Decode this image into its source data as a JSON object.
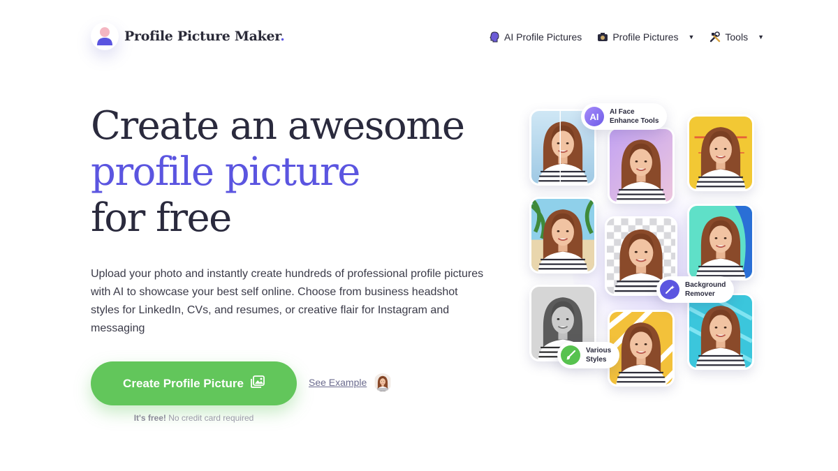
{
  "brand": {
    "name": "Profile Picture Maker",
    "dot": "."
  },
  "nav": {
    "ai_profile_pictures": "AI Profile Pictures",
    "profile_pictures": "Profile Pictures",
    "tools": "Tools"
  },
  "hero": {
    "line1": "Create an awesome",
    "line2": "profile picture",
    "line3": "for free",
    "description": "Upload your photo and instantly create hundreds of professional profile pictures with AI to showcase your best self online. Choose from business headshot styles for LinkedIn, CVs, and resumes, or creative flair for Instagram and messaging"
  },
  "cta": {
    "button_label": "Create Profile Picture",
    "see_example": "See Example",
    "free_bold": "It's free!",
    "free_rest": " No credit card required"
  },
  "collage": {
    "chips": {
      "ai_badge": "AI",
      "ai_line1": "AI Face",
      "ai_line2": "Enhance Tools",
      "bg_line1": "Background",
      "bg_line2": "Remover",
      "styles_line1": "Various",
      "styles_line2": "Styles"
    }
  },
  "colors": {
    "accent": "#5b55e0",
    "cta_green": "#62c65b",
    "headline": "#2a2a3d"
  }
}
